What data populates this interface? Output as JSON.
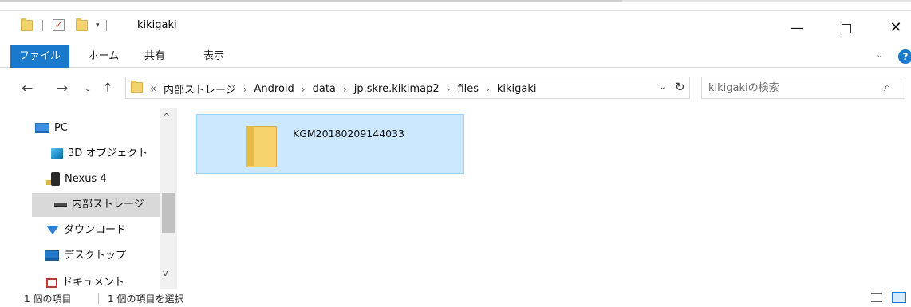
{
  "window": {
    "title": "kikigaki",
    "minimize_glyph": "—",
    "close_glyph": "✕"
  },
  "quick_access": {
    "dropdown_glyph": "▾"
  },
  "ribbon": {
    "tabs": [
      "ファイル",
      "ホーム",
      "共有",
      "表示"
    ],
    "expand_glyph": "⌄",
    "help_glyph": "?"
  },
  "nav": {
    "back_glyph": "←",
    "forward_glyph": "→",
    "recent_glyph": "⌄",
    "up_glyph": "↑"
  },
  "address": {
    "overflow": "«",
    "crumbs": [
      "内部ストレージ",
      "Android",
      "data",
      "jp.skre.kikimap2",
      "files",
      "kikigaki"
    ],
    "separator": "›",
    "dropdown_glyph": "⌄",
    "refresh_glyph": "↻"
  },
  "search": {
    "placeholder": "kikigakiの検索",
    "icon_glyph": "⌕"
  },
  "tree": {
    "items": [
      {
        "label": "PC",
        "icon": "pc-icon"
      },
      {
        "label": "3D オブジェクト",
        "icon": "3d-objects-icon"
      },
      {
        "label": "Nexus 4",
        "icon": "phone-icon"
      },
      {
        "label": "内部ストレージ",
        "icon": "drive-icon",
        "selected": true
      },
      {
        "label": "ダウンロード",
        "icon": "download-icon"
      },
      {
        "label": "デスクトップ",
        "icon": "desktop-icon"
      },
      {
        "label": "ドキュメント",
        "icon": "documents-icon"
      }
    ],
    "scroll_up_glyph": "^",
    "scroll_down_glyph": "v"
  },
  "content": {
    "items": [
      {
        "name": "KGM20180209144033",
        "type": "folder",
        "selected": true
      }
    ]
  },
  "status": {
    "item_count": "1 個の項目",
    "selected_count": "1 個の項目を選択"
  },
  "colors": {
    "accent": "#1979ca",
    "selection": "#cce8ff",
    "selection_border": "#99d1ff"
  }
}
